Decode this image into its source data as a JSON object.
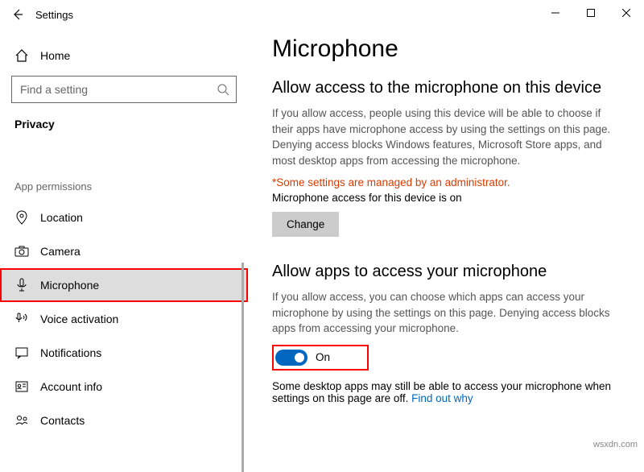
{
  "window": {
    "title": "Settings"
  },
  "sidebar": {
    "home": "Home",
    "search_placeholder": "Find a setting",
    "section": "Privacy",
    "group": "App permissions",
    "items": [
      {
        "label": "Location"
      },
      {
        "label": "Camera"
      },
      {
        "label": "Microphone"
      },
      {
        "label": "Voice activation"
      },
      {
        "label": "Notifications"
      },
      {
        "label": "Account info"
      },
      {
        "label": "Contacts"
      }
    ]
  },
  "page": {
    "heading": "Microphone",
    "section1_title": "Allow access to the microphone on this device",
    "section1_desc": "If you allow access, people using this device will be able to choose if their apps have microphone access by using the settings on this page. Denying access blocks Windows features, Microsoft Store apps, and most desktop apps from accessing the microphone.",
    "admin_note": "*Some settings are managed by an administrator.",
    "device_status": "Microphone access for this device is on",
    "change_btn": "Change",
    "section2_title": "Allow apps to access your microphone",
    "section2_desc": "If you allow access, you can choose which apps can access your microphone by using the settings on this page. Denying access blocks apps from accessing your microphone.",
    "toggle_label": "On",
    "footer_text": "Some desktop apps may still be able to access your microphone when settings on this page are off. ",
    "footer_link": "Find out why"
  },
  "watermark": "wsxdn.com"
}
